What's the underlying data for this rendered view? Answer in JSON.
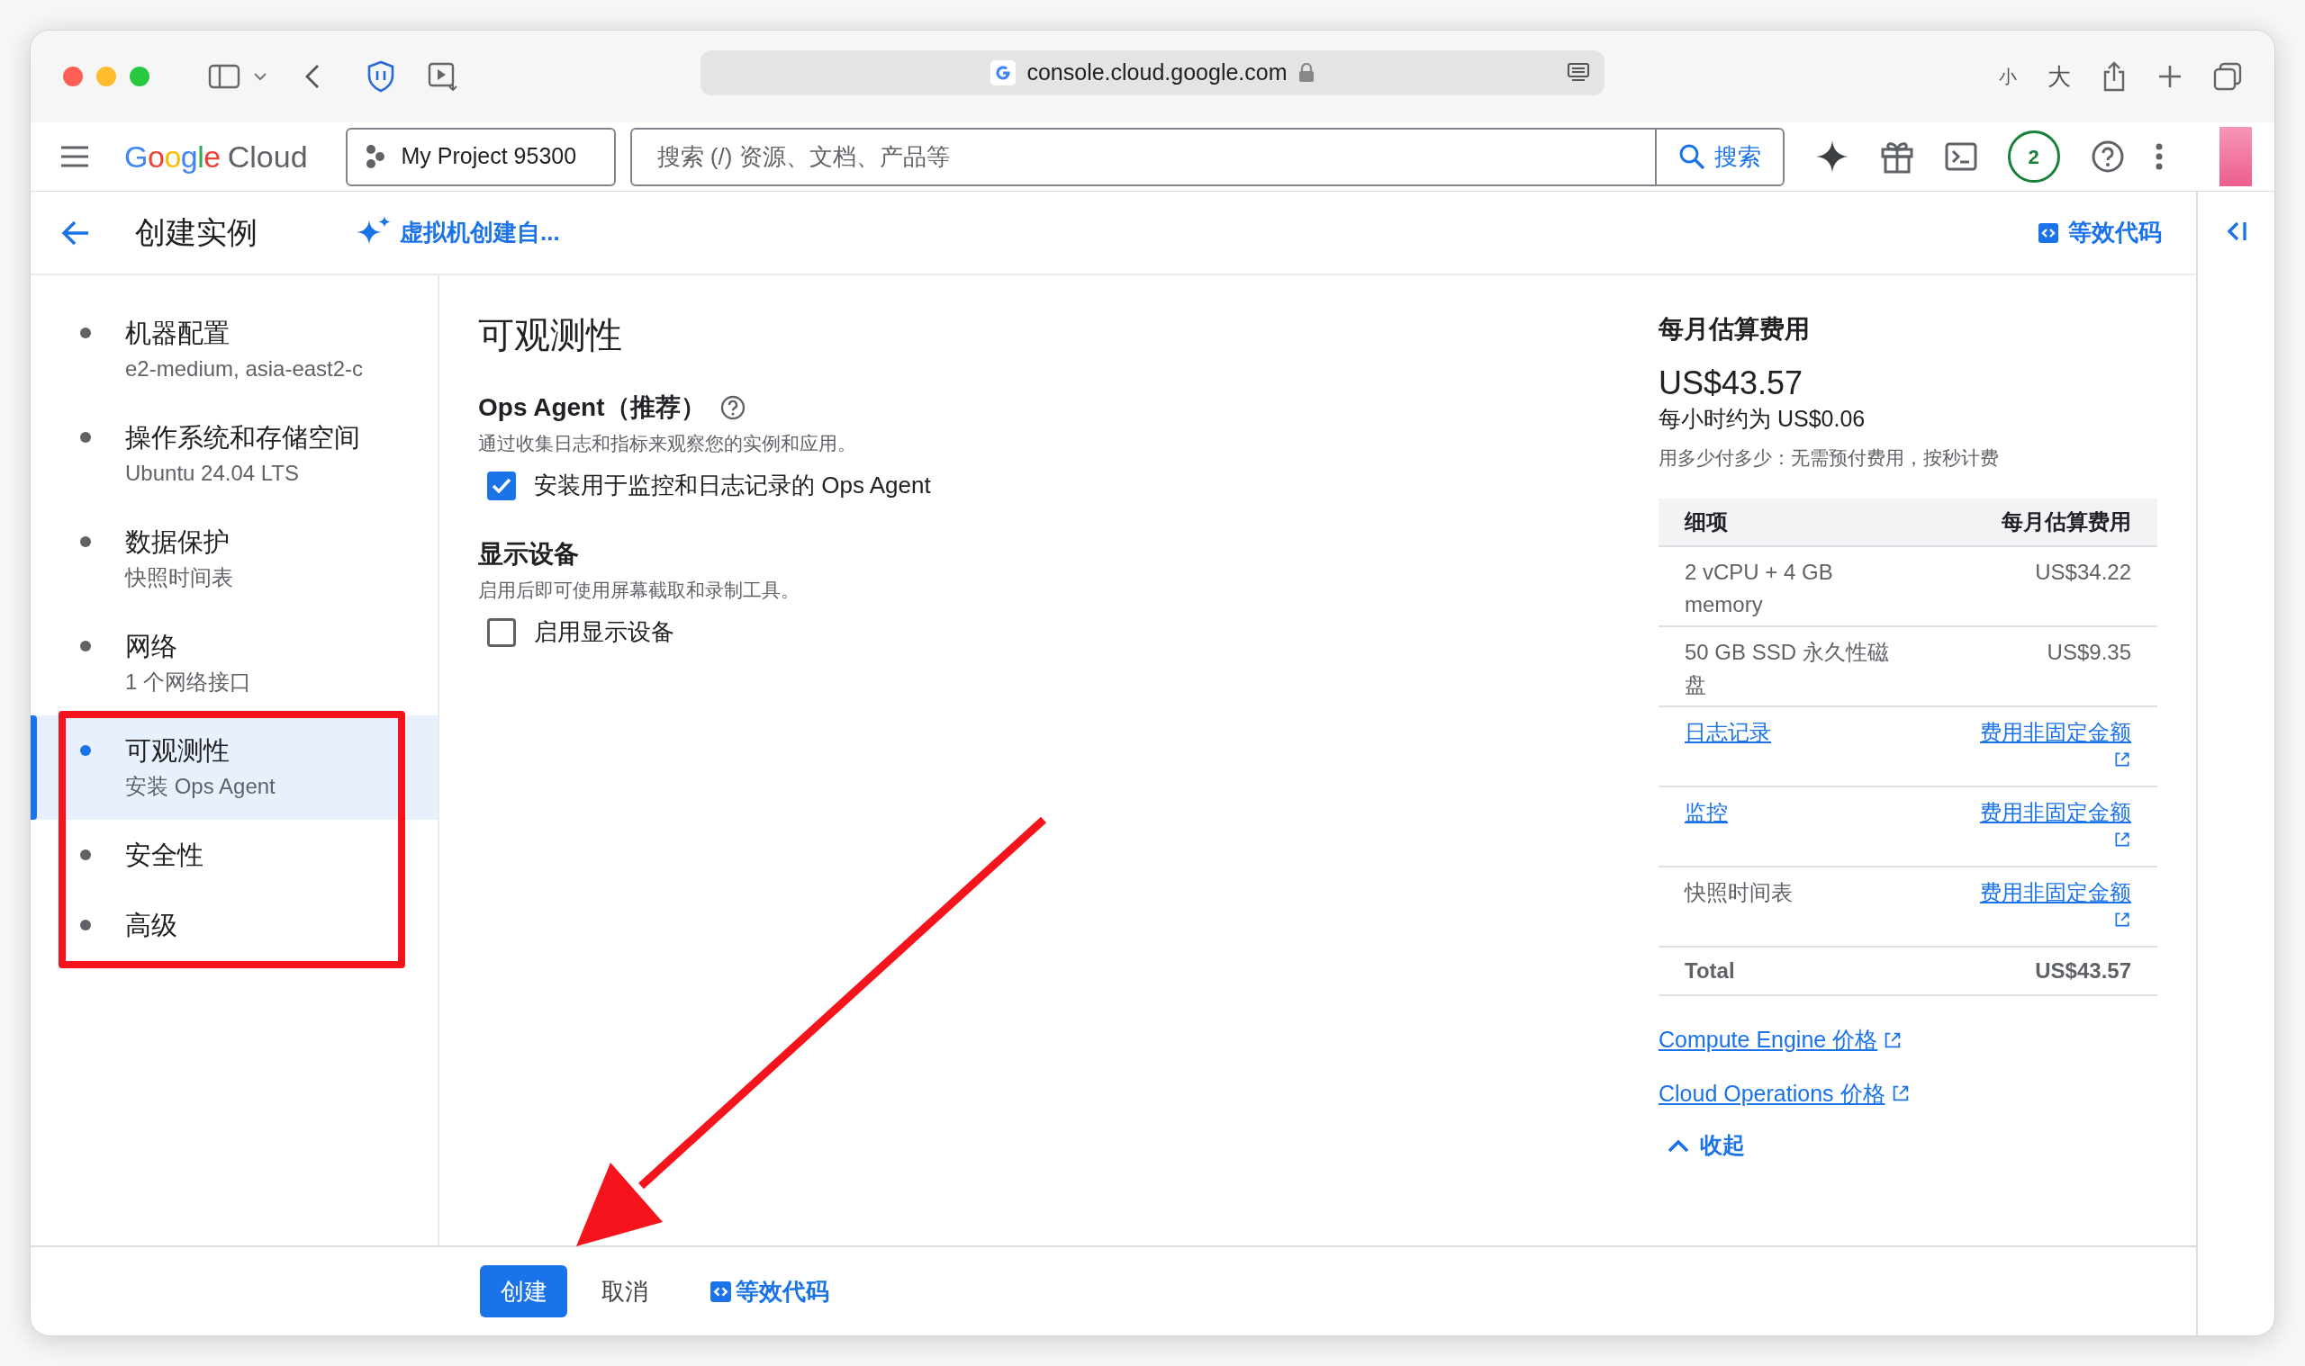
{
  "browser": {
    "url": "console.cloud.google.com",
    "text_smaller": "小",
    "text_larger": "大"
  },
  "header": {
    "logo_brand": "Google",
    "logo_product": "Cloud",
    "project": "My Project 95300",
    "search_placeholder": "搜索 (/) 资源、文档、产品等",
    "search_button": "搜索",
    "notification_count": "2"
  },
  "page_header": {
    "title": "创建实例",
    "assistant_link": "虚拟机创建自...",
    "code_link": "等效代码"
  },
  "sidebar": {
    "items": [
      {
        "title": "机器配置",
        "subtitle": "e2-medium, asia-east2-c",
        "selected": false
      },
      {
        "title": "操作系统和存储空间",
        "subtitle": "Ubuntu 24.04 LTS",
        "selected": false
      },
      {
        "title": "数据保护",
        "subtitle": "快照时间表",
        "selected": false
      },
      {
        "title": "网络",
        "subtitle": "1 个网络接口",
        "selected": false
      },
      {
        "title": "可观测性",
        "subtitle": "安装 Ops Agent",
        "selected": true
      },
      {
        "title": "安全性",
        "selected": false
      },
      {
        "title": "高级",
        "selected": false
      }
    ]
  },
  "section": {
    "title": "可观测性",
    "groups": [
      {
        "title": "Ops Agent（推荐）",
        "has_help": true,
        "description": "通过收集日志和指标来观察您的实例和应用。",
        "checkbox": {
          "label": "安装用于监控和日志记录的 Ops Agent",
          "checked": true
        }
      },
      {
        "title": "显示设备",
        "has_help": false,
        "description": "启用后即可使用屏幕截取和录制工具。",
        "checkbox": {
          "label": "启用显示设备",
          "checked": false
        }
      }
    ]
  },
  "cost": {
    "title": "每月估算费用",
    "amount": "US$43.57",
    "hourly": "每小时约为 US$0.06",
    "note": "用多少付多少：无需预付费用，按秒计费",
    "columns": [
      "细项",
      "每月估算费用"
    ],
    "rows": [
      {
        "item": "2 vCPU + 4 GB memory",
        "cost": "US$34.22",
        "item_link": false,
        "cost_link": false
      },
      {
        "item": "50 GB SSD 永久性磁盘",
        "cost": "US$9.35",
        "item_link": false,
        "cost_link": false
      },
      {
        "item": "日志记录",
        "cost": "费用非固定金额",
        "item_link": true,
        "cost_link": true
      },
      {
        "item": "监控",
        "cost": "费用非固定金额",
        "item_link": true,
        "cost_link": true
      },
      {
        "item": "快照时间表",
        "cost": "费用非固定金额",
        "item_link": false,
        "cost_link": true
      }
    ],
    "total": {
      "label": "Total",
      "value": "US$43.57"
    },
    "links": [
      "Compute Engine 价格",
      "Cloud Operations 价格"
    ],
    "collapse": "收起"
  },
  "footer": {
    "create": "创建",
    "cancel": "取消",
    "code_link": "等效代码"
  }
}
